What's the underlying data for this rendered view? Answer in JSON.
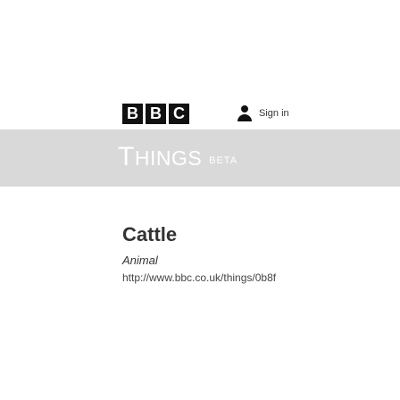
{
  "header": {
    "brand_letters": [
      "B",
      "B",
      "C"
    ],
    "signin_label": "Sign in"
  },
  "banner": {
    "title_first": "T",
    "title_rest": "HINGS",
    "badge": "BETA",
    "background": "#d9d9d9"
  },
  "entity": {
    "title": "Cattle",
    "type": "Animal",
    "uri": "http://www.bbc.co.uk/things/0b8f"
  }
}
